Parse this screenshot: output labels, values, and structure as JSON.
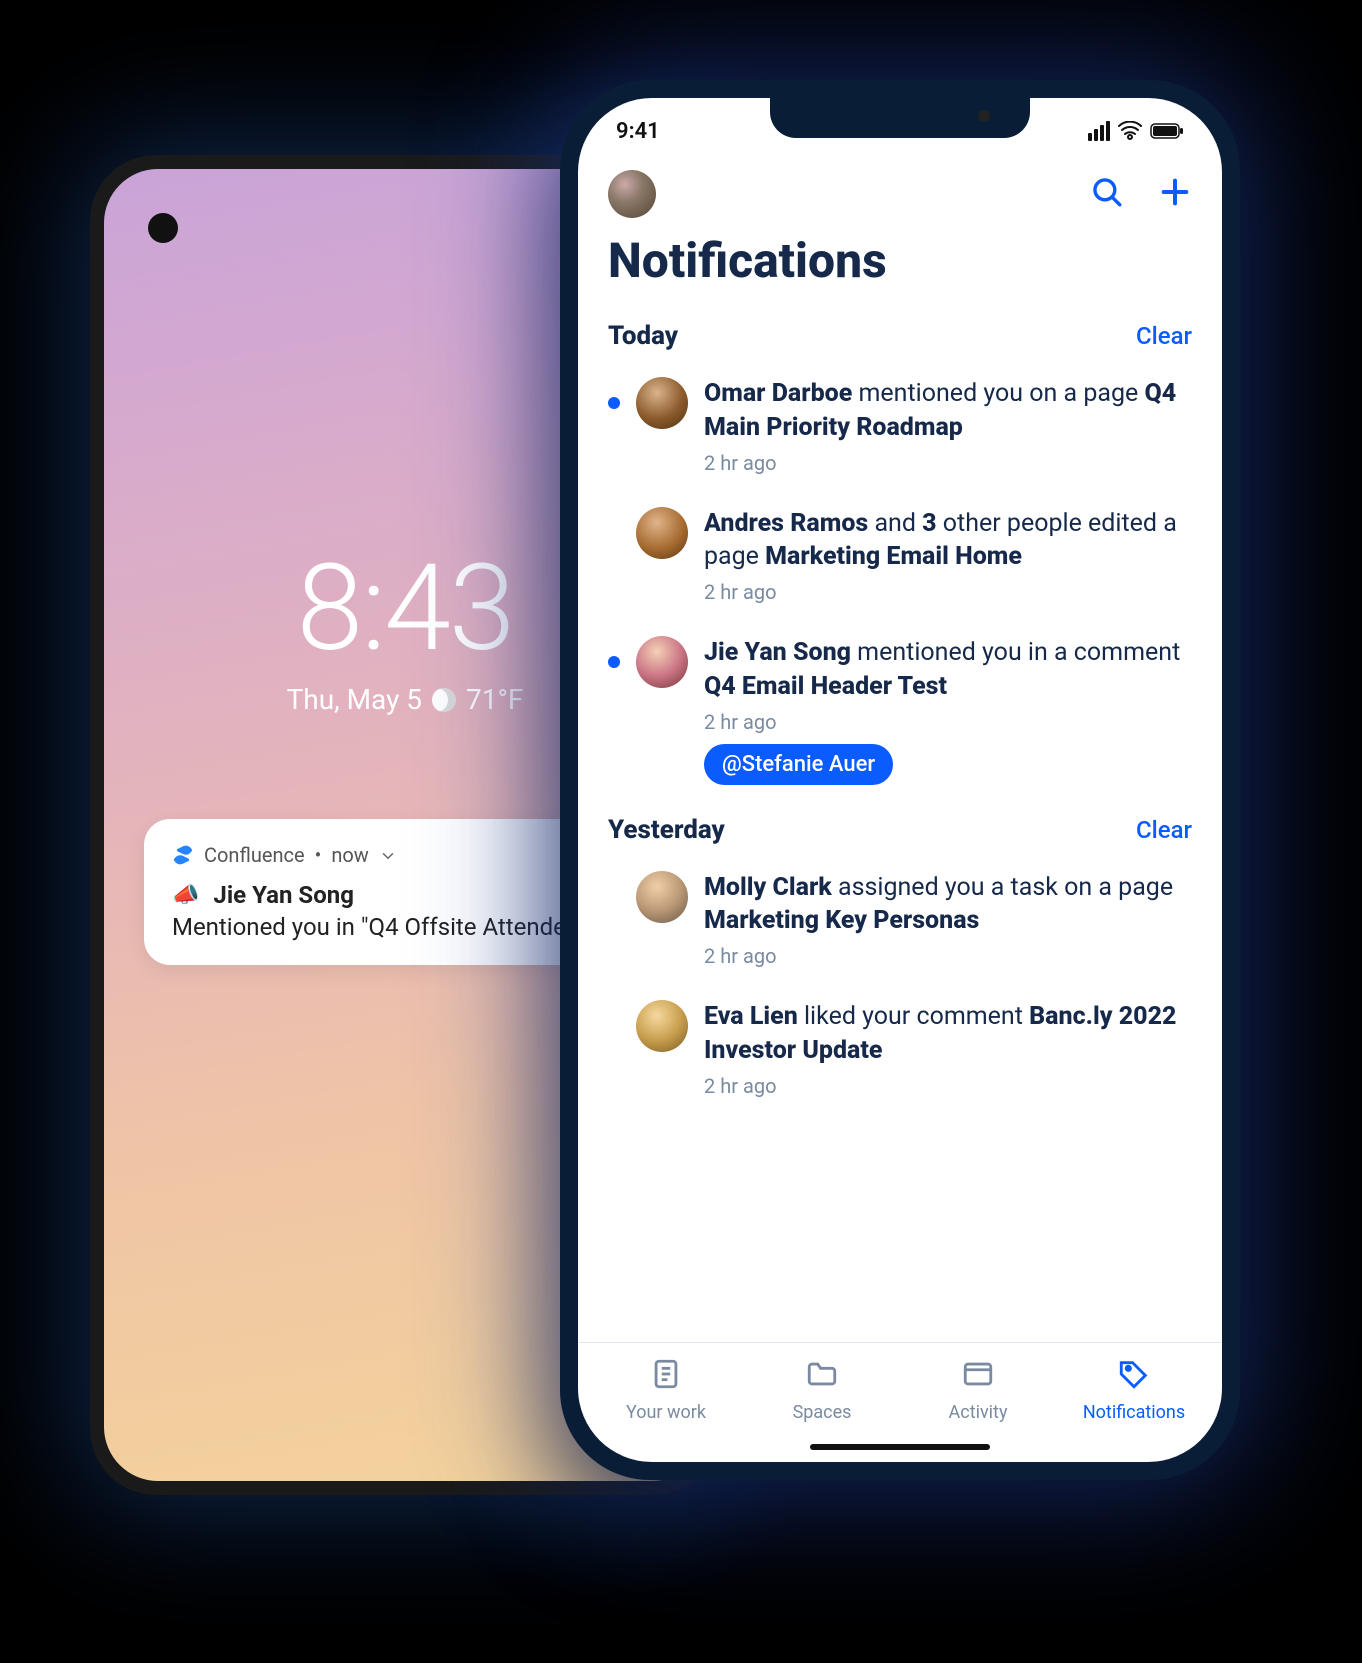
{
  "android": {
    "time": "8:43",
    "date": "Thu, May 5",
    "temp": "71°F",
    "notification": {
      "app": "Confluence",
      "when": "now",
      "actor": "Jie Yan Song",
      "body": "Mentioned you in \"Q4 Offsite Attende"
    }
  },
  "iphone": {
    "status_time": "9:41",
    "page_title": "Notifications",
    "groups": [
      {
        "title": "Today",
        "clear": "Clear",
        "items": [
          {
            "unread": true,
            "avatar_class": "av-omar",
            "actor": "Omar Darboe",
            "mid": " mentioned you on a page ",
            "target": "Q4 Main Priority Roadmap",
            "meta": "2 hr ago",
            "mention": null
          },
          {
            "unread": false,
            "avatar_class": "av-andres",
            "actor": "Andres Ramos",
            "mid_a": " and ",
            "count": "3",
            "mid_b": " other people edited a page ",
            "target": "Marketing Email Home",
            "meta": "2 hr ago",
            "mention": null
          },
          {
            "unread": true,
            "avatar_class": "av-jie",
            "actor": "Jie Yan Song",
            "mid": " mentioned you in a comment ",
            "target": "Q4 Email Header Test",
            "meta": "2 hr ago",
            "mention": "@Stefanie Auer"
          }
        ]
      },
      {
        "title": "Yesterday",
        "clear": "Clear",
        "items": [
          {
            "unread": false,
            "avatar_class": "av-molly",
            "actor": "Molly Clark",
            "mid": " assigned you a task on a page ",
            "target": "Marketing Key Personas",
            "meta": "2 hr ago",
            "mention": null
          },
          {
            "unread": false,
            "avatar_class": "av-eva",
            "actor": "Eva Lien",
            "mid": " liked your comment ",
            "target": "Banc.ly 2022 Investor Update",
            "meta": "2 hr ago",
            "mention": null
          }
        ]
      }
    ],
    "tabs": [
      {
        "label": "Your work",
        "icon": "doc"
      },
      {
        "label": "Spaces",
        "icon": "folder"
      },
      {
        "label": "Activity",
        "icon": "window"
      },
      {
        "label": "Notifications",
        "icon": "tag",
        "active": true
      }
    ]
  }
}
